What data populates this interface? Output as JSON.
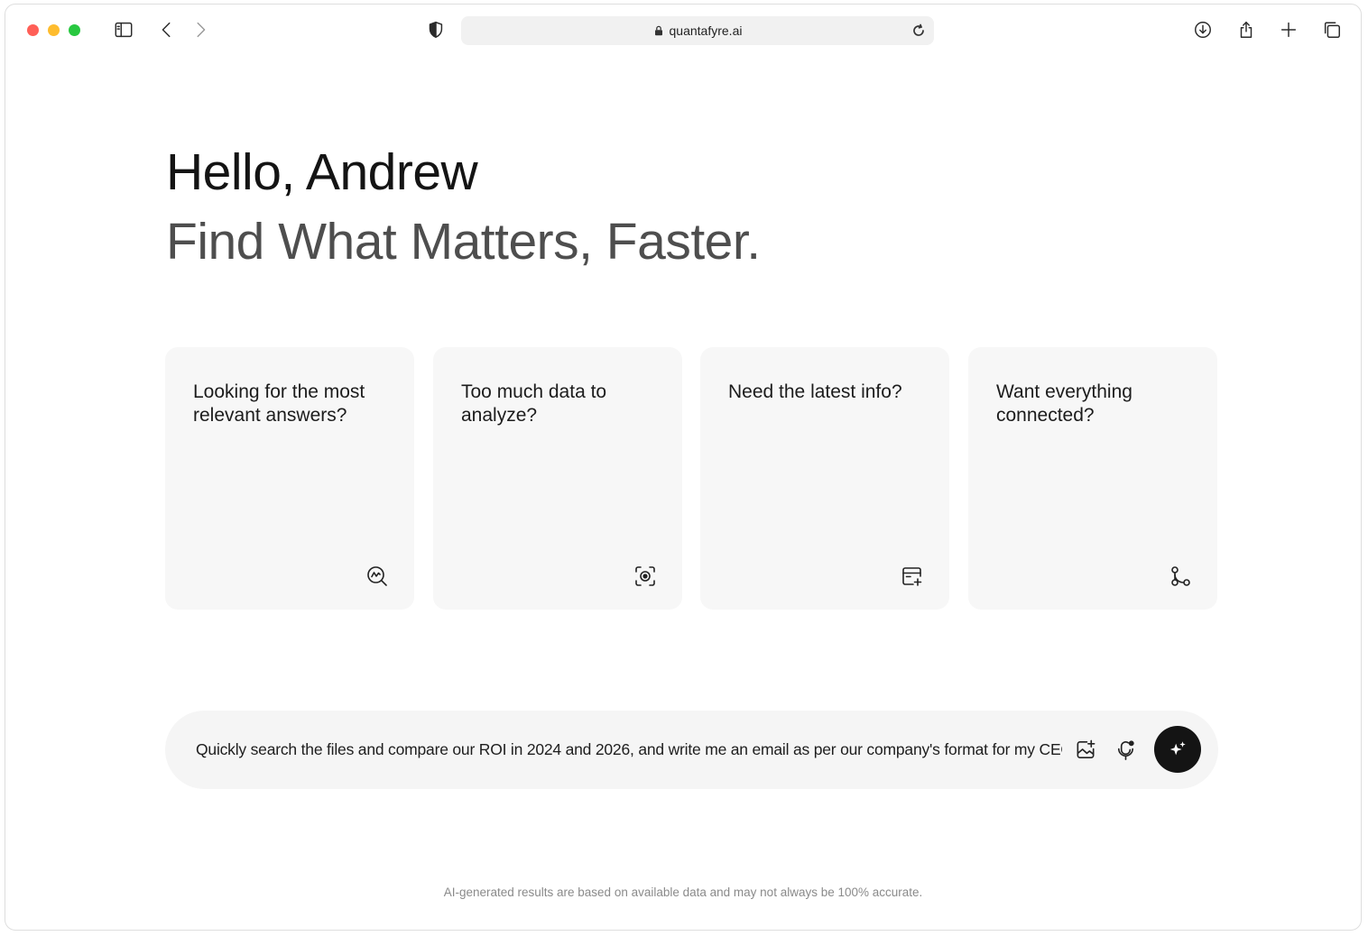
{
  "browser": {
    "url": "quantafyre.ai",
    "colors": {
      "close": "#ff5f57",
      "minimize": "#febc2e",
      "zoom": "#28c840"
    }
  },
  "hero": {
    "greeting": "Hello, Andrew",
    "tagline": "Find What Matters, Faster."
  },
  "cards": [
    {
      "title": "Looking for the most relevant answers?",
      "icon": "analytics-search-icon"
    },
    {
      "title": "Too much data to analyze?",
      "icon": "focus-scan-icon"
    },
    {
      "title": "Need the latest info?",
      "icon": "calendar-add-icon"
    },
    {
      "title": "Want everything connected?",
      "icon": "connection-nodes-icon"
    }
  ],
  "prompt": {
    "value": "Quickly search the files and compare our ROI in 2024 and 2026, and write me an email as per our company's format for my CEO"
  },
  "footer": {
    "disclaimer": "AI-generated results are based on available data and may not always be 100% accurate."
  }
}
